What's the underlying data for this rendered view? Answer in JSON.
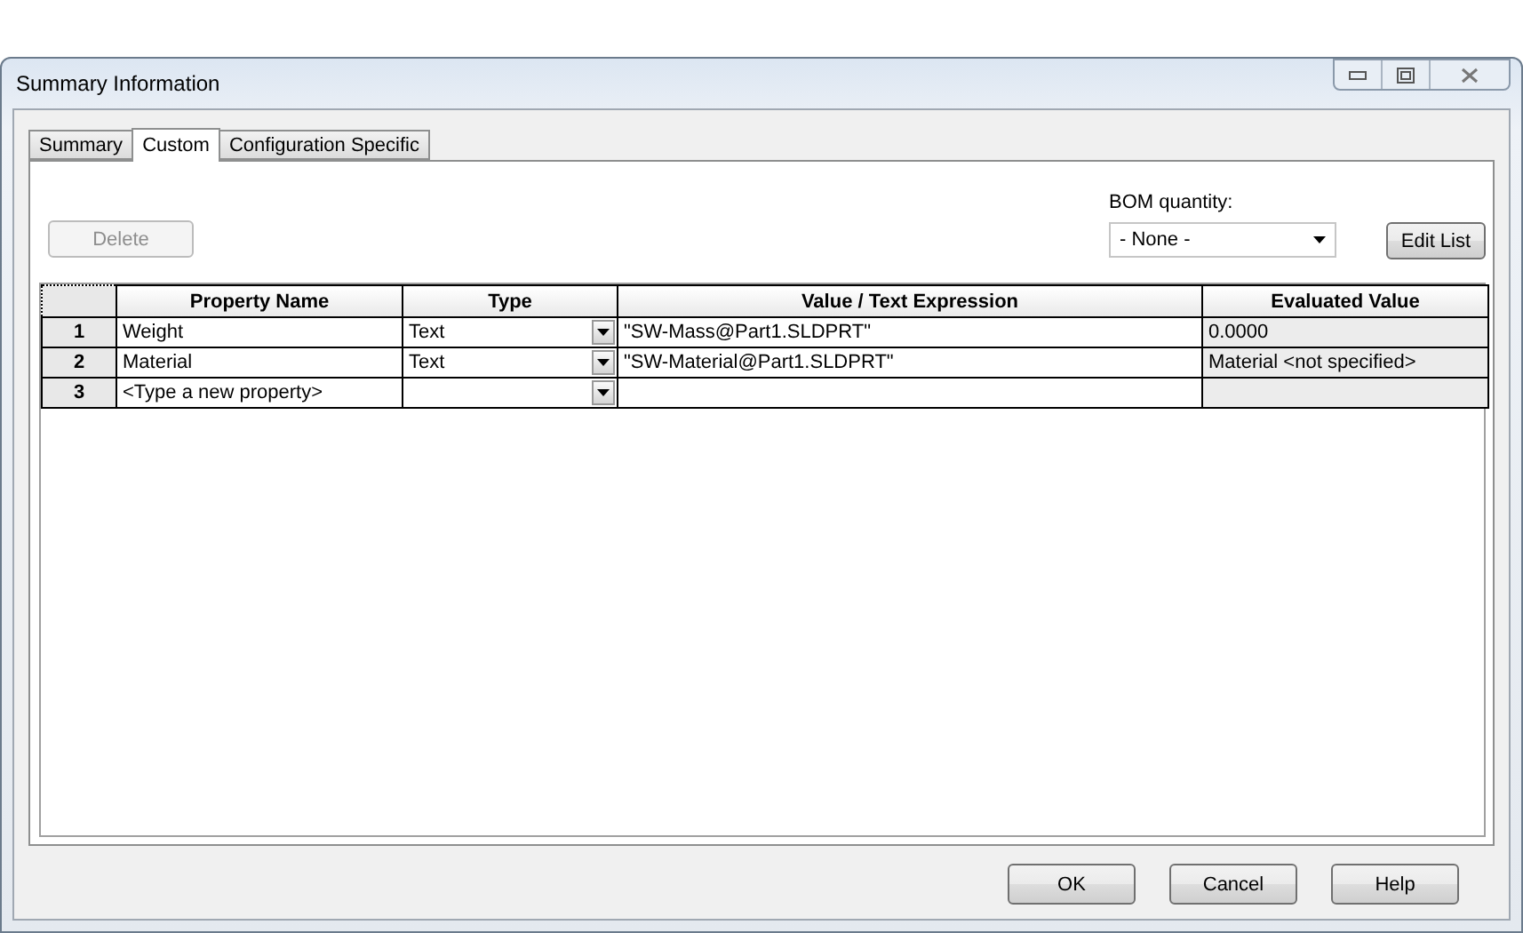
{
  "window": {
    "title": "Summary Information"
  },
  "tabs": [
    {
      "label": "Summary",
      "selected": false
    },
    {
      "label": "Custom",
      "selected": true
    },
    {
      "label": "Configuration Specific",
      "selected": false
    }
  ],
  "delete_button": {
    "label": "Delete",
    "disabled": true
  },
  "bom_quantity": {
    "label": "BOM quantity:",
    "value": "- None -"
  },
  "edit_list_button": {
    "label": "Edit List"
  },
  "table": {
    "columns": [
      "Property Name",
      "Type",
      "Value / Text Expression",
      "Evaluated Value"
    ],
    "rows": [
      {
        "number": "1",
        "name": "Weight",
        "type": "Text",
        "value": "\"SW-Mass@Part1.SLDPRT\"",
        "evaluated": "0.0000"
      },
      {
        "number": "2",
        "name": "Material",
        "type": "Text",
        "value": "\"SW-Material@Part1.SLDPRT\"",
        "evaluated": "Material <not specified>"
      },
      {
        "number": "3",
        "name": "<Type a new property>",
        "type": "",
        "value": "",
        "evaluated": ""
      }
    ]
  },
  "buttons": [
    "OK",
    "Cancel",
    "Help"
  ]
}
